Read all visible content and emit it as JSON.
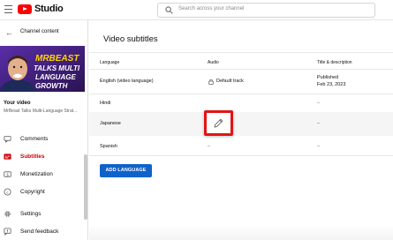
{
  "topbar": {
    "brand": "Studio",
    "search_placeholder": "Search across your channel"
  },
  "sidebar": {
    "back_label": "Channel content",
    "thumbnail_text_line1": "MRBEAST",
    "thumbnail_text_line2": "TALKS MULTI",
    "thumbnail_text_line3": "LANGUAGE",
    "thumbnail_text_line4": "GROWTH",
    "your_video_label": "Your video",
    "video_title": "MrBeast Talks Multi-Language Strat...",
    "items": [
      {
        "label": "Comments",
        "icon": "comment-icon",
        "active": false
      },
      {
        "label": "Subtitles",
        "icon": "subtitles-icon",
        "active": true
      },
      {
        "label": "Monetization",
        "icon": "dollar-icon",
        "active": false
      },
      {
        "label": "Copyright",
        "icon": "copyright-icon",
        "active": false
      },
      {
        "label": "Settings",
        "icon": "gear-icon",
        "active": false
      },
      {
        "label": "Send feedback",
        "icon": "feedback-icon",
        "active": false
      }
    ]
  },
  "main": {
    "title": "Video subtitles",
    "columns": [
      "Language",
      "Audio",
      "Title & description"
    ],
    "rows": [
      {
        "language": "English (video language)",
        "audio": "Default track",
        "title_desc": "Published",
        "title_desc_date": "Feb 23, 2023"
      },
      {
        "language": "Hindi",
        "audio": "",
        "title_desc": "–",
        "title_desc_date": ""
      },
      {
        "language": "Japanese",
        "audio": "",
        "title_desc": "–",
        "title_desc_date": ""
      },
      {
        "language": "Spanish",
        "audio": "–",
        "title_desc": "–",
        "title_desc_date": ""
      }
    ],
    "add_language_label": "ADD LANGUAGE"
  },
  "colors": {
    "accent_red": "#cc0000",
    "highlight_border": "#e01515",
    "button_blue": "#0f62c9",
    "thumbnail_bg": "#3a1f6e"
  }
}
